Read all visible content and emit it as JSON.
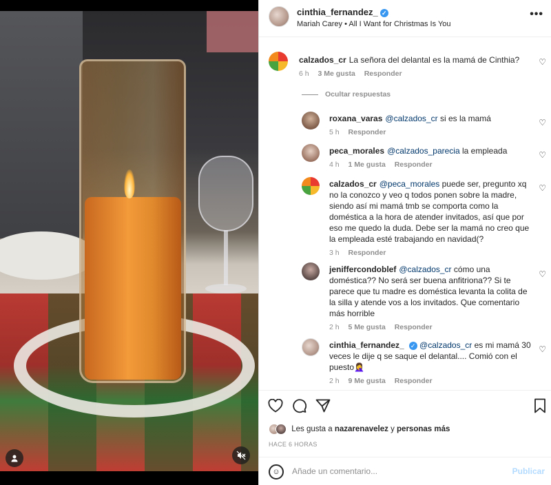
{
  "header": {
    "username": "cinthia_fernandez_",
    "verified_icon": "verified-badge-icon",
    "song": "Mariah Carey • All I Want for Christmas Is You",
    "more_icon": "more-options-icon"
  },
  "hide_replies_label": "Ocultar respuestas",
  "comments": [
    {
      "user": "calzados_cr",
      "text": "La señora del delantal es la mamá de Cinthia?",
      "time": "6 h",
      "likes": "3 Me gusta",
      "reply": "Responder"
    },
    {
      "user": "roxana_varas",
      "mention": "@calzados_cr",
      "text": "si es la mamá",
      "time": "5 h",
      "likes": "",
      "reply": "Responder"
    },
    {
      "user": "peca_morales",
      "mention": "@calzados_parecia",
      "text": "la empleada",
      "time": "4 h",
      "likes": "1 Me gusta",
      "reply": "Responder"
    },
    {
      "user": "calzados_cr",
      "mention": "@peca_morales",
      "text": "puede ser, pregunto xq no la conozco y veo q todos ponen sobre la madre, siendo así mi mamá tmb se comporta como la doméstica a la hora de atender invitados, así que por eso me quedo la duda. Debe ser la mamá no creo que la empleada esté trabajando en navidad(?",
      "time": "3 h",
      "likes": "",
      "reply": "Responder"
    },
    {
      "user": "jeniffercondoblef",
      "mention": "@calzados_cr",
      "text": "cómo una doméstica?? No será ser buena anfitriona?? Si te parece que tu madre es doméstica levanta la colita de la silla y atende vos a los invitados. Que comentario más horrible",
      "time": "2 h",
      "likes": "5 Me gusta",
      "reply": "Responder"
    },
    {
      "user": "cinthia_fernandez_",
      "mention": "@calzados_cr",
      "text": "es mi mamá 30 veces le dije q se saque el delantal.... Comió con el puesto🤦‍♀️",
      "time": "2 h",
      "likes": "9 Me gusta",
      "reply": "Responder"
    }
  ],
  "likes": {
    "prefix": "Les gusta a",
    "user": "nazarenavelez",
    "connector": "y",
    "others": "personas más"
  },
  "time_ago": "HACE 6 HORAS",
  "add_comment": {
    "placeholder": "Añade un comentario...",
    "publish": "Publicar"
  },
  "colors": {
    "link": "#00376b",
    "muted": "#8e8e8e",
    "verified": "#3897f0",
    "publish_disabled": "#b3dbff"
  }
}
